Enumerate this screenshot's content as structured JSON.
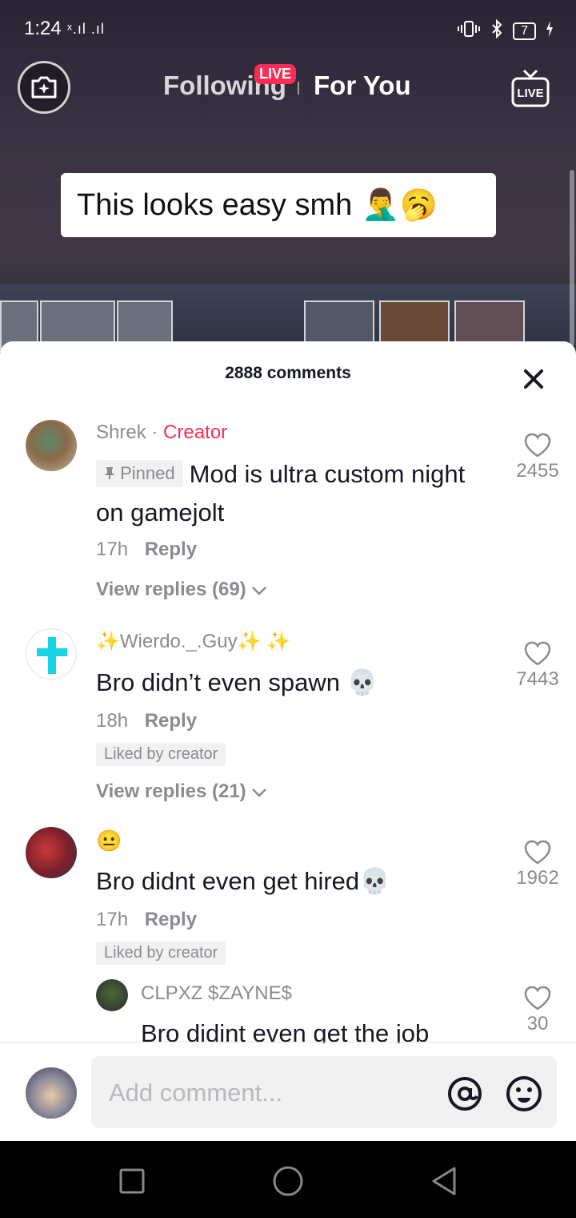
{
  "status_bar": {
    "time": "1:24",
    "signal": "ˣ.ıl .ıl",
    "battery": "7"
  },
  "top_nav": {
    "following_label": "Following",
    "live_badge": "LIVE",
    "for_you_label": "For You",
    "live_button_label": "LIVE"
  },
  "video": {
    "caption": "This looks easy smh",
    "caption_emojis": "🤦‍♂️🥱"
  },
  "comments_sheet": {
    "count_label": "2888 comments",
    "comments": [
      {
        "username": "Shrek",
        "separator": "·",
        "creator_label": "Creator",
        "pinned_label": "Pinned",
        "text": "Mod is ultra custom night on gamejolt",
        "time": "17h",
        "reply_label": "Reply",
        "view_replies": "View replies (69)",
        "likes": "2455"
      },
      {
        "username": "✨Wierdo._.Guy✨ ✨",
        "text": "Bro didn’t even spawn 💀",
        "time": "18h",
        "reply_label": "Reply",
        "liked_by": "Liked by creator",
        "view_replies": "View replies (21)",
        "likes": "7443"
      },
      {
        "username": "😐",
        "text": "Bro didnt even get hired💀",
        "time": "17h",
        "reply_label": "Reply",
        "liked_by": "Liked by creator",
        "likes": "1962"
      },
      {
        "username": "CLPXZ $ZAYNE$",
        "text": "Bro didint even get the job",
        "likes": "30"
      }
    ],
    "input_placeholder": "Add comment..."
  }
}
